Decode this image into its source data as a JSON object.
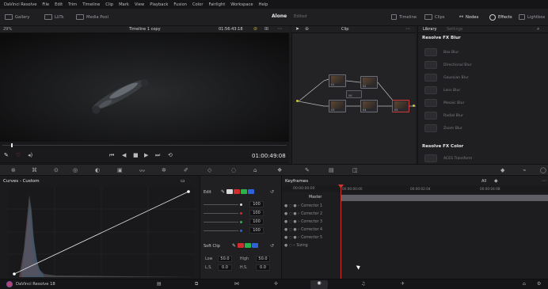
{
  "menubar": {
    "items": [
      "DaVinci Resolve",
      "File",
      "Edit",
      "Trim",
      "Timeline",
      "Clip",
      "Mark",
      "View",
      "Playback",
      "Fusion",
      "Color",
      "Fairlight",
      "Workspace",
      "Help"
    ]
  },
  "toolbar": {
    "left": [
      {
        "label": "Gallery",
        "icon": "gallery-icon"
      },
      {
        "label": "LUTs",
        "icon": "luts-icon"
      },
      {
        "label": "Media Pool",
        "icon": "media-pool-icon"
      }
    ],
    "project_name": "Alone",
    "project_status": "Edited",
    "right": [
      {
        "label": "Timeline",
        "icon": "timeline-icon"
      },
      {
        "label": "Clips",
        "icon": "clips-icon"
      },
      {
        "label": "Nodes",
        "icon": "nodes-icon"
      },
      {
        "label": "Effects",
        "icon": "effects-icon"
      },
      {
        "label": "Lightbox",
        "icon": "lightbox-icon"
      }
    ]
  },
  "viewer": {
    "zoom": "29%",
    "timeline_name": "Timeline 1 copy",
    "timecode": "01:56:43:18",
    "clip_label": "Clip",
    "current_time": "01:00:49:08"
  },
  "library": {
    "tab_active": "Library",
    "tab_other": "Settings",
    "section_blur": "Resolve FX Blur",
    "blur_items": [
      "Box Blur",
      "Directional Blur",
      "Gaussian Blur",
      "Lens Blur",
      "Mosaic Blur",
      "Radial Blur",
      "Zoom Blur"
    ],
    "section_color": "Resolve FX Color",
    "color_items": [
      "ACES Transform"
    ]
  },
  "nodes": [
    {
      "label": "01"
    },
    {
      "label": "02"
    },
    {
      "label": "03"
    },
    {
      "label": "04"
    },
    {
      "label": "05"
    },
    {
      "label": "06"
    }
  ],
  "curves": {
    "title": "Curves - Custom",
    "edit_label": "Edit",
    "channel_values": [
      "100",
      "100",
      "100",
      "100"
    ],
    "soft_clip_label": "Soft Clip",
    "low_label": "Low",
    "low_value": "50.0",
    "high_label": "High",
    "high_value": "50.0",
    "ls_label": "L.S.",
    "ls_value": "0.0",
    "hs_label": "H.S.",
    "hs_value": "0.0",
    "colors": {
      "y": "#d9d9d9",
      "r": "#d22b2b",
      "g": "#2bb34a",
      "b": "#2f62d6"
    }
  },
  "keyframes": {
    "title": "Keyframes",
    "mode": "All",
    "time_master": "00:00:00:00",
    "tick_1": "00:00:00:00",
    "tick_2": "00:00:02:04",
    "tick_3": "00:00:04:08",
    "rows": [
      "Master",
      "Corrector 1",
      "Corrector 2",
      "Corrector 3",
      "Corrector 4",
      "Corrector 5",
      "Sizing"
    ]
  },
  "status": {
    "app_label": "DaVinci Resolve 18"
  }
}
